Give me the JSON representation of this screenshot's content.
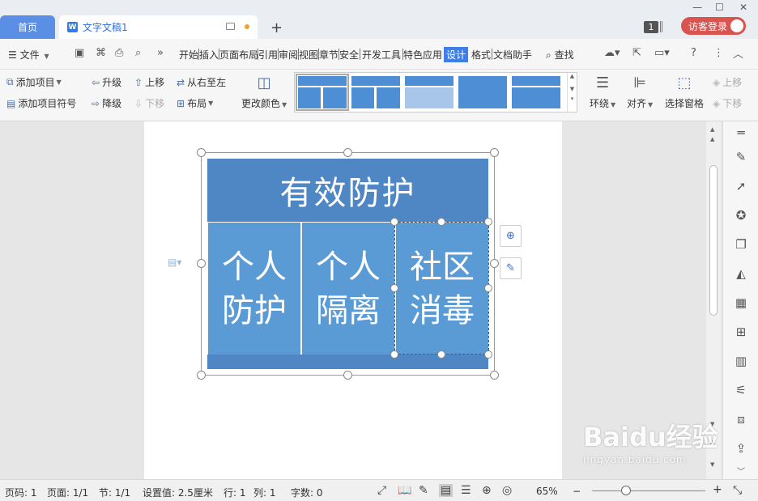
{
  "tabs": {
    "home": "首页",
    "doc": "文字文稿1"
  },
  "titlebar": {
    "badge": "1",
    "login": "访客登录",
    "new_tab": "+"
  },
  "menu": {
    "file": "文件",
    "items": [
      "开始",
      "插入",
      "页面布局",
      "引用",
      "审阅",
      "视图",
      "章节",
      "安全",
      "开发工具",
      "特色应用",
      "设计",
      "格式",
      "文档助手"
    ],
    "active": "设计",
    "search": "查找"
  },
  "ribbon": {
    "add_item": "添加项目",
    "add_bullet": "添加项目符号",
    "promote": "升级",
    "demote": "降级",
    "move_up": "上移",
    "move_down": "下移",
    "rtl": "从右至左",
    "layout": "布局",
    "change_color": "更改颜色",
    "wrap": "环绕",
    "align": "对齐",
    "selection_pane": "选择窗格",
    "bring_forward": "上移",
    "send_backward": "下移"
  },
  "smartart": {
    "header": "有效防护",
    "cells": [
      "个人防护",
      "个人隔离",
      "社区消毒"
    ]
  },
  "colors": {
    "header": "#4f87c5",
    "cell": "#5b9bd5",
    "accent": "#3d7ee8",
    "login": "#d9534f"
  },
  "status": {
    "page_num": "页码: 1",
    "pages": "页面: 1/1",
    "section": "节: 1/1",
    "setting": "设置值: 2.5厘米",
    "row": "行: 1",
    "col": "列: 1",
    "words": "字数: 0",
    "zoom": "65%"
  },
  "watermark": {
    "brand": "Baidu经验",
    "url": "jingyan.baidu.com"
  }
}
